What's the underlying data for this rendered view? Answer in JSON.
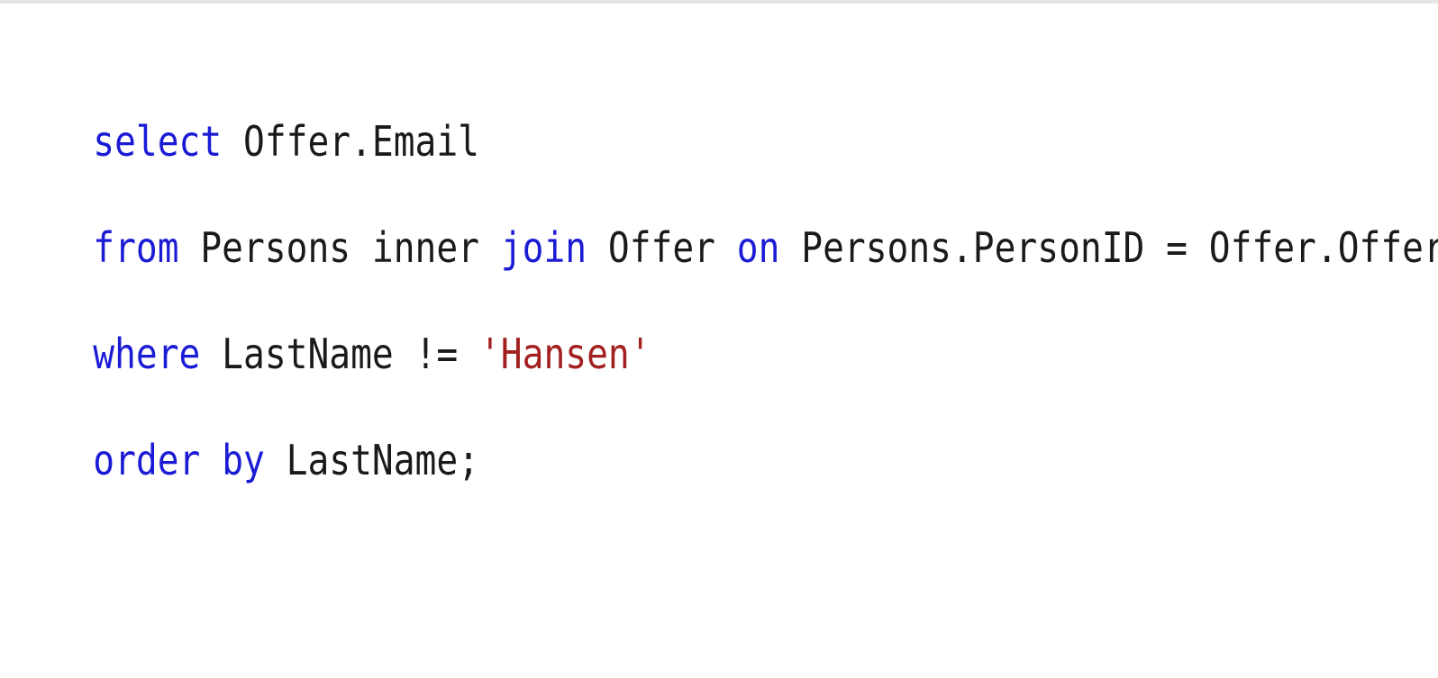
{
  "colors": {
    "keyword": "#1b1bd6",
    "string": "#a32020",
    "plain": "#1a1a1a"
  },
  "code": {
    "lines": [
      [
        {
          "text": "select",
          "kind": "kw"
        },
        {
          "text": " Offer.Email",
          "kind": "plain"
        }
      ],
      [
        {
          "text": "from",
          "kind": "kw"
        },
        {
          "text": " Persons inner ",
          "kind": "plain"
        },
        {
          "text": "join",
          "kind": "kw"
        },
        {
          "text": " Offer ",
          "kind": "plain"
        },
        {
          "text": "on",
          "kind": "kw"
        },
        {
          "text": " Persons.PersonID = Offer.OfferId",
          "kind": "plain"
        }
      ],
      [
        {
          "text": "where",
          "kind": "kw"
        },
        {
          "text": " LastName != ",
          "kind": "plain"
        },
        {
          "text": "'Hansen'",
          "kind": "str"
        }
      ],
      [
        {
          "text": "order",
          "kind": "kw"
        },
        {
          "text": " ",
          "kind": "plain"
        },
        {
          "text": "by",
          "kind": "kw"
        },
        {
          "text": " LastName;",
          "kind": "plain"
        }
      ]
    ]
  }
}
